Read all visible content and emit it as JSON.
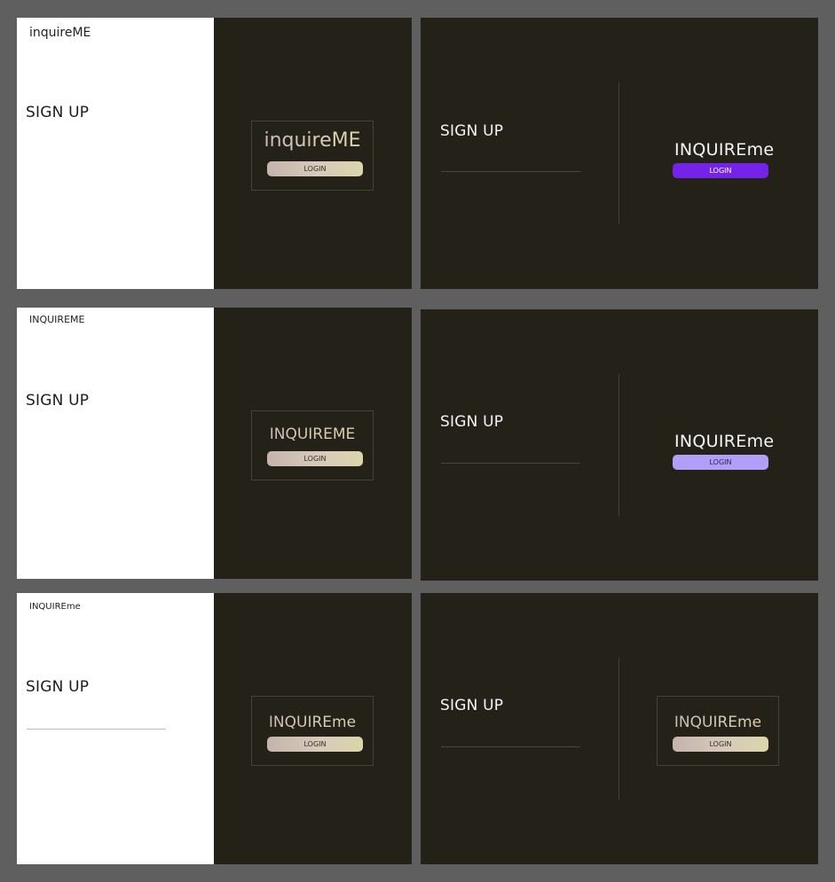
{
  "colors": {
    "canvas": "#5f5f5f",
    "dark_panel": "#242119",
    "white_panel": "#ffffff",
    "purple_button": "#7523ea",
    "lavender_button": "#b09ef8",
    "gold_gradient_start": "#c5b3ad",
    "gold_gradient_end": "#dbd5ab"
  },
  "variants": [
    {
      "left": {
        "logo": "inquireME",
        "signup": "SIGN UP",
        "card_logo": "inquireME",
        "login": "LOGIN"
      },
      "right": {
        "signup": "SIGN UP",
        "logo": "INQUIREme",
        "login": "LOGIN",
        "login_color": "purple"
      }
    },
    {
      "left": {
        "logo": "INQUIREME",
        "signup": "SIGN UP",
        "card_logo": "INQUIREME",
        "login": "LOGIN"
      },
      "right": {
        "signup": "SIGN UP",
        "logo": "INQUIREme",
        "login": "LOGIN",
        "login_color": "lavender"
      }
    },
    {
      "left": {
        "logo": "INQUIREme",
        "signup": "SIGN UP",
        "card_logo": "INQUIREme",
        "login": "LOGIN"
      },
      "right": {
        "signup": "SIGN UP",
        "logo": "INQUIREme",
        "login": "LOGIN",
        "login_color": "gradient"
      }
    }
  ]
}
